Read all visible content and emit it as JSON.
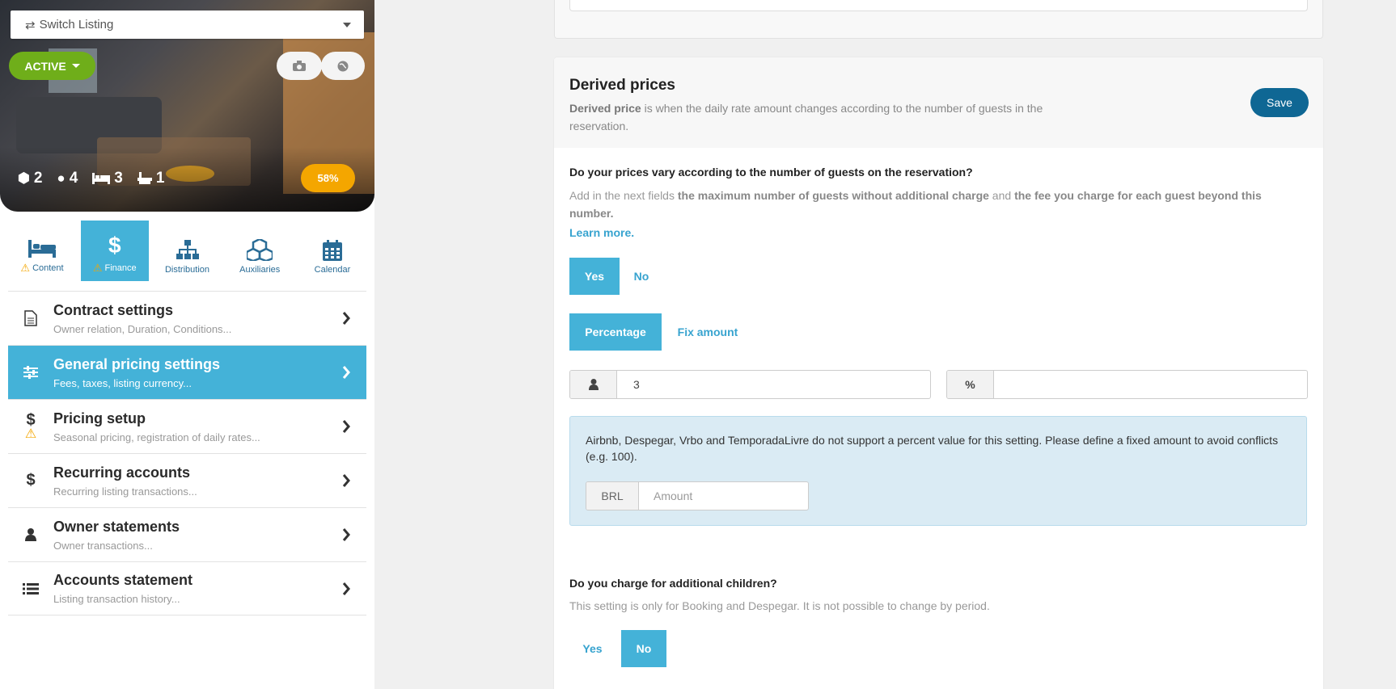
{
  "listing": {
    "switch_label": "Switch Listing",
    "status": "ACTIVE",
    "completion": "58%",
    "stats": {
      "rooms": "2",
      "guests": "4",
      "beds": "3",
      "baths": "1"
    }
  },
  "tabs": [
    {
      "label": "Content",
      "warning": true
    },
    {
      "label": "Finance",
      "warning": true
    },
    {
      "label": "Distribution",
      "warning": false
    },
    {
      "label": "Auxiliaries",
      "warning": false
    },
    {
      "label": "Calendar",
      "warning": false
    }
  ],
  "menu": [
    {
      "title": "Contract settings",
      "subtitle": "Owner relation, Duration, Conditions..."
    },
    {
      "title": "General pricing settings",
      "subtitle": "Fees, taxes, listing currency..."
    },
    {
      "title": "Pricing setup",
      "subtitle": "Seasonal pricing, registration of daily rates..."
    },
    {
      "title": "Recurring accounts",
      "subtitle": "Recurring listing transactions..."
    },
    {
      "title": "Owner statements",
      "subtitle": "Owner transactions..."
    },
    {
      "title": "Accounts statement",
      "subtitle": "Listing transaction history..."
    }
  ],
  "derived": {
    "title": "Derived prices",
    "desc_bold": "Derived price",
    "desc_rest": " is when the daily rate amount changes according to the number of guests in the reservation.",
    "save_label": "Save",
    "q1": "Do your prices vary according to the number of guests on the reservation?",
    "q1_desc_a": "Add in the next fields ",
    "q1_desc_b": "the maximum number of guests without additional charge",
    "q1_desc_c": " and ",
    "q1_desc_d": "the fee you charge for each guest beyond this number.",
    "learn_more": "Learn more.",
    "yes": "Yes",
    "no": "No",
    "percentage": "Percentage",
    "fix_amount": "Fix amount",
    "guests_value": "3",
    "percent_symbol": "%",
    "percent_value": "",
    "alert_text": "Airbnb, Despegar, Vrbo and TemporadaLivre do not support a percent value for this setting. Please define a fixed amount to avoid conflicts (e.g. 100).",
    "currency": "BRL",
    "amount_placeholder": "Amount",
    "q2": "Do you charge for additional children?",
    "q2_desc": "This setting is only for Booking and Despegar. It is not possible to change by period.",
    "q2_yes": "Yes",
    "q2_no": "No"
  },
  "colors": {
    "accent": "#44b2d8",
    "save": "#0f6794",
    "active": "#6fae1a",
    "warning": "#f4a600"
  }
}
